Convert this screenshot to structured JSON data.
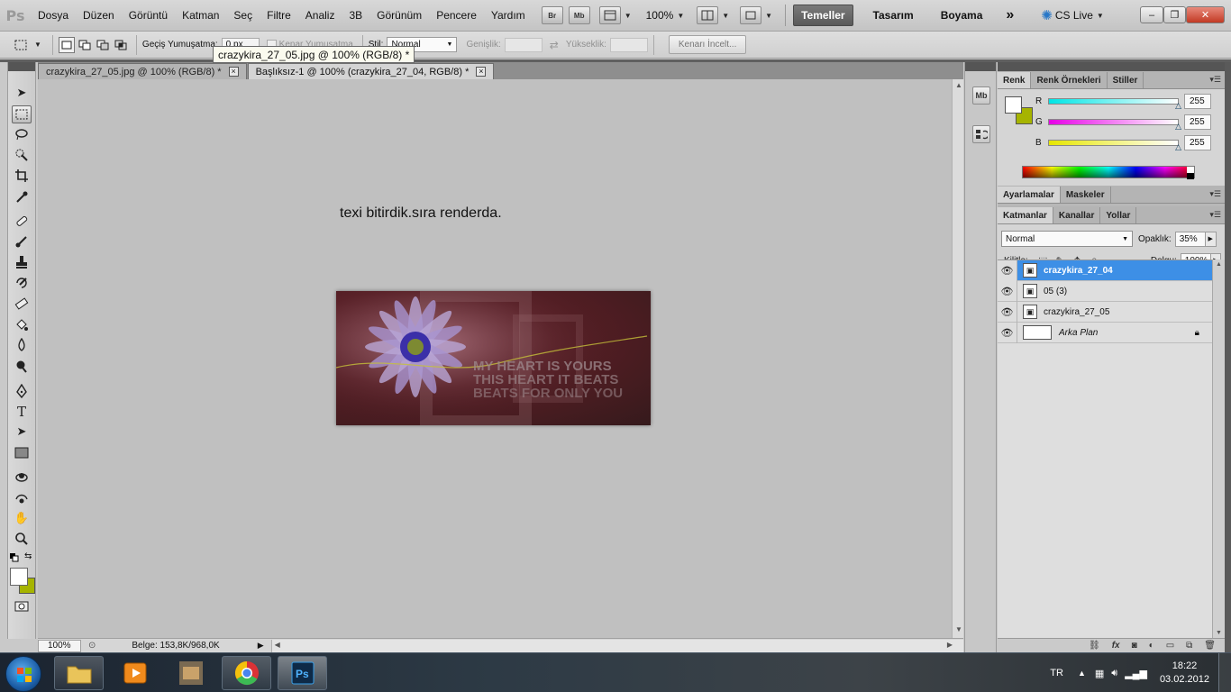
{
  "menubar": {
    "logo": "Ps",
    "items": [
      "Dosya",
      "Düzen",
      "Görüntü",
      "Katman",
      "Seç",
      "Filtre",
      "Analiz",
      "3B",
      "Görünüm",
      "Pencere",
      "Yardım"
    ],
    "bridge_label": "Br",
    "minibridge_label": "Mb",
    "zoom": "100%",
    "workspaces": [
      "Temeller",
      "Tasarım",
      "Boyama"
    ],
    "active_workspace": "Temeller",
    "more": "»",
    "cs_live": "CS Live"
  },
  "options": {
    "feather_label": "Geçiş Yumuşatma:",
    "feather_value": "0 px",
    "antialias_label": "Kenar Yumuşatma",
    "style_label": "Stil:",
    "style_value": "Normal",
    "width_label": "Genişlik:",
    "height_label": "Yükseklik:",
    "refine_edge": "Kenarı İncelt..."
  },
  "tooltip": "crazykira_27_05.jpg @ 100% (RGB/8) *",
  "documents": {
    "tabs": [
      {
        "label": "crazykira_27_05.jpg @ 100% (RGB/8) *",
        "active": false
      },
      {
        "label": "Başlıksız-1 @ 100% (crazykira_27_04, RGB/8) *",
        "active": true
      }
    ],
    "close_glyph": "×",
    "canvas_text": "texi bitirdik.sıra renderda.",
    "artwork_lines": [
      "MY HEART IS YOURS",
      "THIS HEART IT BEATS",
      "BEATS FOR ONLY YOU"
    ]
  },
  "status": {
    "zoom": "100%",
    "doc_info": "Belge: 153,8K/968,0K"
  },
  "color_panel": {
    "tabs": [
      "Renk",
      "Renk Örnekleri",
      "Stiller"
    ],
    "channels": [
      {
        "label": "R",
        "value": "255",
        "color": "#00e5e5"
      },
      {
        "label": "G",
        "value": "255",
        "color": "#e600e6"
      },
      {
        "label": "B",
        "value": "255",
        "color": "#e6e600"
      }
    ],
    "foreground": "#ffffff",
    "background": "#a6b400"
  },
  "adjustments_panel": {
    "tabs": [
      "Ayarlamalar",
      "Maskeler"
    ]
  },
  "layers_panel": {
    "tabs": [
      "Katmanlar",
      "Kanallar",
      "Yollar"
    ],
    "blend_mode": "Normal",
    "opacity_label": "Opaklık:",
    "opacity_value": "35%",
    "lock_label": "Kilitle:",
    "fill_label": "Dolgu:",
    "fill_value": "100%",
    "layers": [
      {
        "name": "crazykira_27_04",
        "selected": true
      },
      {
        "name": "05 (3)",
        "selected": false
      },
      {
        "name": "crazykira_27_05",
        "selected": false
      },
      {
        "name": "Arka Plan",
        "selected": false,
        "locked": true
      }
    ],
    "footer_icons": [
      "link-icon",
      "fx-icon",
      "mask-icon",
      "adjustment-icon",
      "group-icon",
      "new-layer-icon",
      "trash-icon"
    ]
  },
  "taskbar": {
    "language": "TR",
    "time": "18:22",
    "date": "03.02.2012"
  }
}
